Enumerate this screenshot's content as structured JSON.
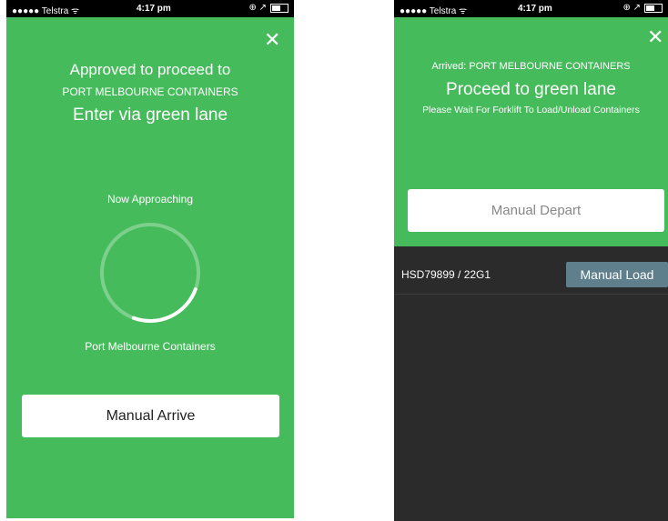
{
  "left": {
    "status": {
      "carrier": "●●●●● Telstra",
      "wifi": "ᯤ",
      "time": "4:17 pm",
      "icons": "⊕ ↗"
    },
    "close_icon": "✕",
    "heading1": "Approved to proceed to",
    "heading2": "PORT MELBOURNE CONTAINERS",
    "heading3": "Enter via green lane",
    "approaching_label": "Now Approaching",
    "destination_label": "Port Melbourne Containers",
    "progress_fraction": 0.25,
    "manual_arrive_label": "Manual Arrive"
  },
  "right": {
    "status": {
      "carrier": "●●●●● Telstra",
      "wifi": "ᯤ",
      "time": "4:17 pm",
      "icons": "⊕ ↗"
    },
    "close_icon": "✕",
    "arrived_label": "Arrived: PORT MELBOURNE CONTAINERS",
    "proceed_label": "Proceed to green lane",
    "wait_label": "Please Wait For Forklift To Load/Unload Containers",
    "manual_depart_label": "Manual Depart",
    "container": {
      "id": "HSD79899 / 22G1",
      "button_label": "Manual Load"
    }
  },
  "colors": {
    "green": "#45bb5b",
    "dark": "#2b2b2b",
    "load_button": "#5f7f8c"
  }
}
